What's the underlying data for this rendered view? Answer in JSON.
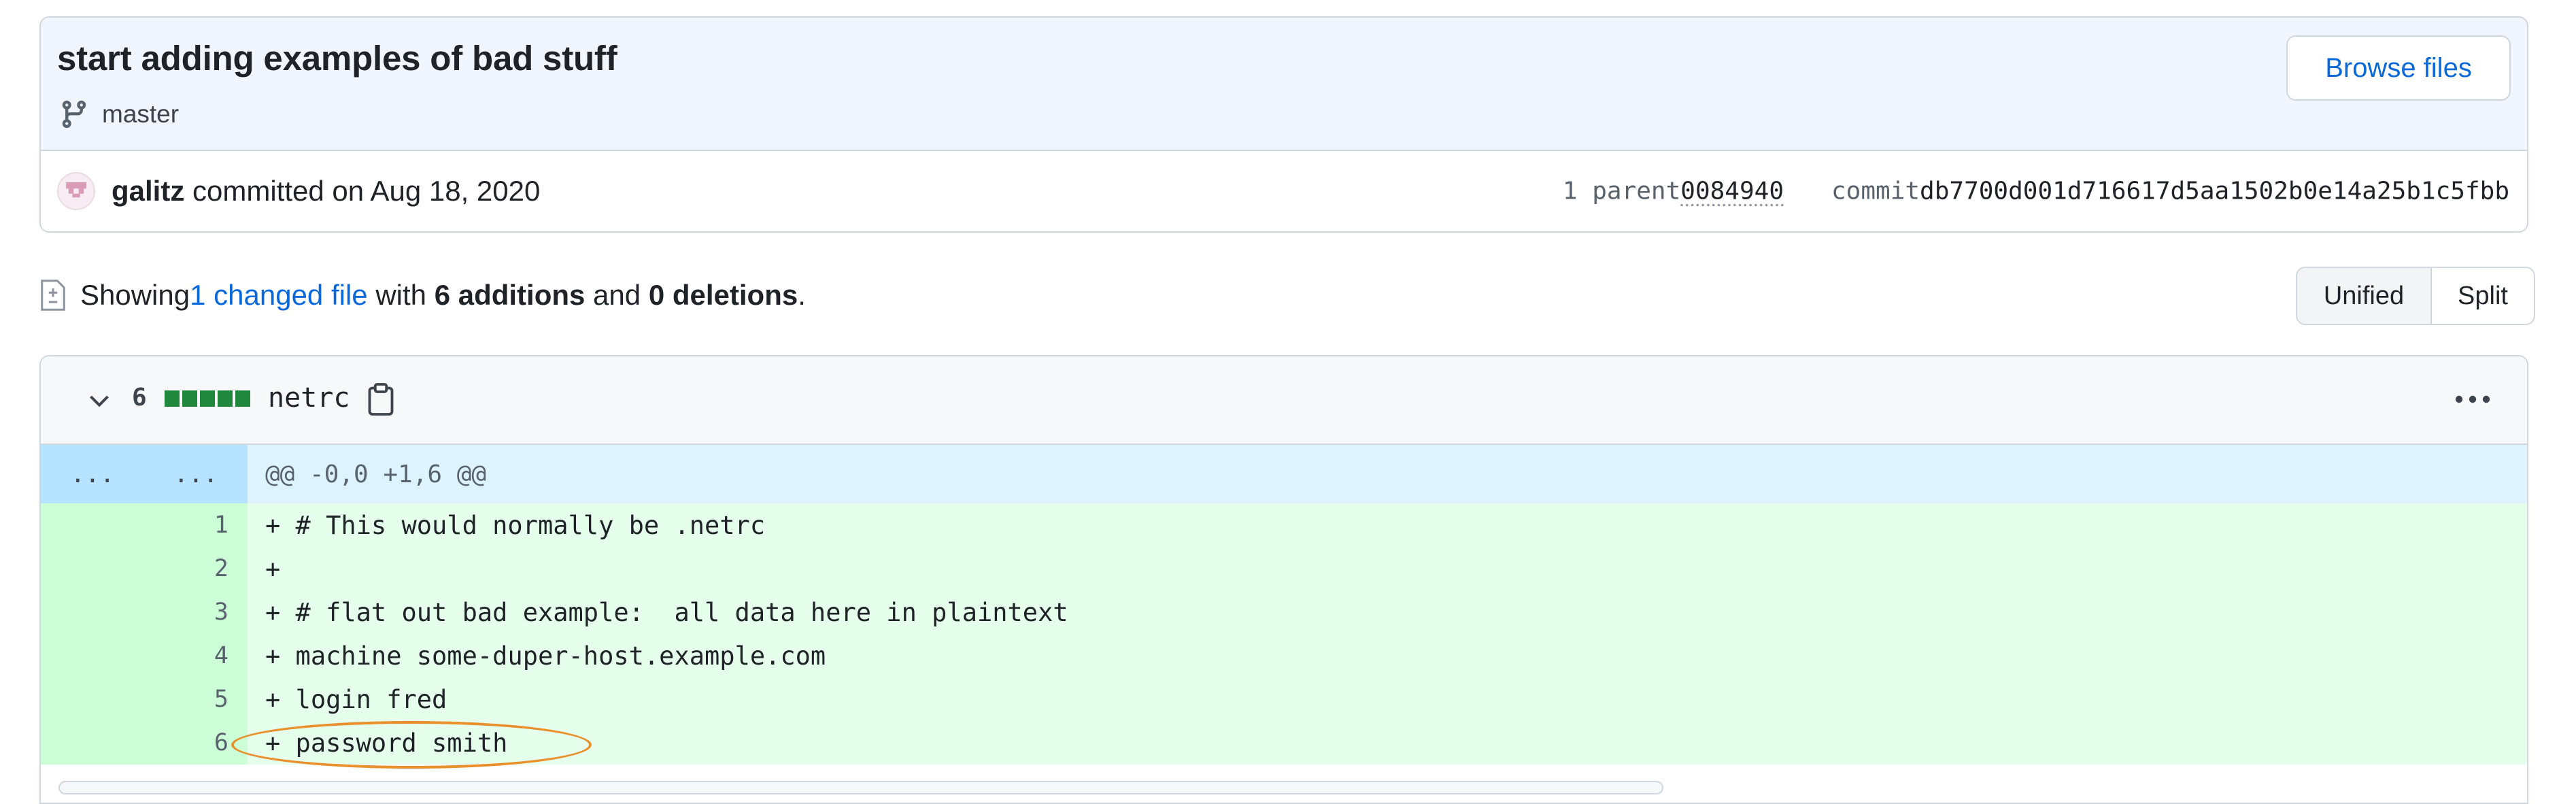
{
  "commit": {
    "title": "start adding examples of bad stuff",
    "branch": "master",
    "browse_label": "Browse files",
    "author": "galitz",
    "committed_text": " committed on Aug 18, 2020",
    "parent_label": "1 parent ",
    "parent_sha": "0084940",
    "commit_label": "commit ",
    "commit_sha": "db7700d001d716617d5aa1502b0e14a25b1c5fbb"
  },
  "summary": {
    "showing": "Showing ",
    "changed_files": "1 changed file",
    "with": " with ",
    "additions": "6 additions",
    "and": " and ",
    "deletions": "0 deletions",
    "end": "."
  },
  "view_toggle": {
    "unified": "Unified",
    "split": "Split"
  },
  "file": {
    "change_count": "6",
    "name": "netrc",
    "hunk_old": "...",
    "hunk_new": "...",
    "hunk_header": "@@ -0,0 +1,6 @@",
    "lines": [
      {
        "num": "1",
        "text": "+ # This would normally be .netrc"
      },
      {
        "num": "2",
        "text": "+"
      },
      {
        "num": "3",
        "text": "+ # flat out bad example:  all data here in plaintext"
      },
      {
        "num": "4",
        "text": "+ machine some-duper-host.example.com"
      },
      {
        "num": "5",
        "text": "+ login fred"
      },
      {
        "num": "6",
        "text": "+ password smith"
      }
    ]
  },
  "colors": {
    "accent": "#0969da",
    "added_bg": "#e6ffec",
    "added_gutter": "#ccffd8",
    "hunk_bg": "#ddf4ff",
    "annotation": "#e9902d"
  },
  "icons": [
    "git-branch-icon",
    "file-diff-icon",
    "chevron-down-icon",
    "copy-icon",
    "kebab-icon"
  ]
}
